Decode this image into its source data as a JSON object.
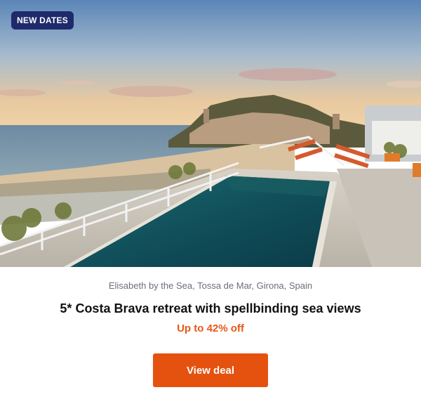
{
  "badge": {
    "label": "NEW DATES"
  },
  "offer": {
    "location": "Elisabeth by the Sea, Tossa de Mar, Girona, Spain",
    "title": "5* Costa Brava retreat with spellbinding sea views",
    "discount": "Up to 42% off",
    "cta_label": "View deal"
  },
  "colors": {
    "badge_bg": "#1f2a6b",
    "discount": "#e8581a",
    "cta_bg": "#e5520f"
  }
}
